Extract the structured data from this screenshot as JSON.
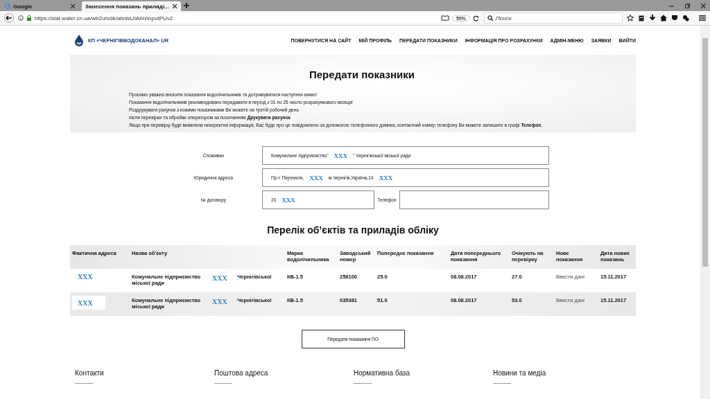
{
  "browser": {
    "tabs": [
      {
        "title": "Google",
        "selected": false
      },
      {
        "title": "Занесення показань приладі...",
        "selected": true
      }
    ],
    "url": "https://stat.water.cn.ua/wb2urvdk/abnlsUIAbn/inputPUv2",
    "zoom": "50%",
    "search": {
      "placeholder": "Поиск"
    }
  },
  "header": {
    "logo_text": "КП «ЧЕРНІГІВВОДОКАНАЛ» UR",
    "nav": [
      "ПОВЕРНУТИСЯ НА САЙТ",
      "МІЙ ПРОФІЛЬ",
      "ПЕРЕДАТИ ПОКАЗНИКИ",
      "ІНФОРМАЦІЯ ПРО РОЗРАХУНКИ",
      "АДМІН-МЕНЮ",
      "ЗАЯВКИ",
      "ВИЙТИ"
    ]
  },
  "banner": {
    "title": "Передати показники",
    "lines": [
      "Просимо уважно вносити показання водолічильників та дотримуватися наступних вимог:",
      "Показання водолічильників рекомендовано передавати в період з 01 по 25 число розрахункового місяця!",
      "Роздрукувати рахунок з новими показниками Ви можете на третій робочий день",
      "після перевірки та обробки оператором за посиланням **Друкувати рахунок**",
      "Якщо при перевірці буде виявлена некоректна інформація, Вас буде про це повідомлено за допомогою телефонного дзвінка, контактний номер телефону Ви можете залишите в графі **Телефон**."
    ]
  },
  "form": {
    "fields": [
      {
        "label": "Споживач",
        "wide": true,
        "value": [
          {
            "kind": "plain",
            "text": "Комунальне підприємство\""
          },
          {
            "kind": "redacted",
            "text": "XXX"
          },
          {
            "kind": "plain",
            "text": "\" Чернігівської міської ради"
          }
        ]
      },
      {
        "label": "Юридична адреса",
        "wide": true,
        "value": [
          {
            "kind": "plain",
            "text": "Пр-т  Перемоги,"
          },
          {
            "kind": "redacted",
            "text": "XXX"
          },
          {
            "kind": "plain",
            "text": "м.Чернігів,Україна,14"
          },
          {
            "kind": "redacted",
            "text": "XXX"
          }
        ]
      },
      {
        "label": "№ договору",
        "wide": false,
        "value": [
          {
            "kind": "plain",
            "text": "20"
          },
          {
            "kind": "redacted",
            "text": "XXX"
          }
        ]
      },
      {
        "label": "Телефон",
        "wide": false
      }
    ]
  },
  "objects": {
    "title": "Перелік об’єктів та приладів обліку",
    "columns": [
      "Фактична адреса",
      "Назва об'єкту",
      "Марка водолічильника",
      "Заводський номер",
      "Попереднє показання",
      "Дата попереднього показання",
      "Очікують на перевірку",
      "Нове показання",
      "Дата нових показань"
    ],
    "rows": [
      {
        "address": "XXX",
        "name": "Комунальне підприємство міської ради",
        "name_mark": "XXX",
        "city": "Чернігівської",
        "brand": "КВ-1.5",
        "serial": "258100",
        "previous": "25.0",
        "previous_date": "08.08.2017",
        "pending": "27.0",
        "action": "Ввести дані",
        "new_date": "15.11.2017"
      },
      {
        "address": "XXX",
        "name": "Комунальне підприємство міської ради",
        "name_mark": "XXX",
        "city": "Чернігівської",
        "brand": "КВ-1.5",
        "serial": "035381",
        "previous": "51.0",
        "previous_date": "08.08.2017",
        "pending": "53.0",
        "action": "Ввести дані",
        "new_date": "15.11.2017"
      }
    ]
  },
  "submit_button": "Передати показання ПО",
  "footer": [
    "Контакти",
    "Поштова адреса",
    "Нормативна база",
    "Новини та медіа"
  ]
}
